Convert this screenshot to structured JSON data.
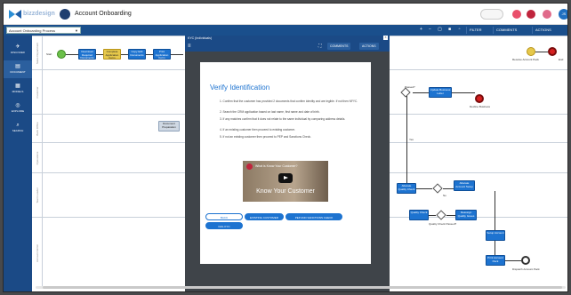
{
  "app": {
    "brand": "bizzdesign",
    "title": "Account Onboarding"
  },
  "toolbar": {
    "process_select": "Account Onboarding Process",
    "filter_label": "FILTER",
    "comments_label": "COMMENTS",
    "actions_label": "ACTIONS",
    "avatar_initials": "JS"
  },
  "sidebar": {
    "items": [
      {
        "label": "DISCOVER",
        "icon": "compass-icon"
      },
      {
        "label": "DOCUMENT",
        "icon": "document-icon"
      },
      {
        "label": "MODELS",
        "icon": "models-icon"
      },
      {
        "label": "EXPLORE",
        "icon": "explore-icon"
      },
      {
        "label": "SEARCH",
        "icon": "search-icon"
      }
    ]
  },
  "diagram": {
    "lanes": [
      "Sales Department",
      "Customer",
      "Back Office",
      "Operations",
      "Team Leader",
      "Account Admin"
    ],
    "tasks": {
      "t1": "Download Required Documents",
      "t2": "Complete Application Form",
      "t3": "Copy Edit Documents",
      "t4": "Print Application Form",
      "t5": "Document Preparation",
      "t6": "Update Business Letter",
      "t7": "Allocate Quality Check",
      "t8": "Allocate Account Setup",
      "t9": "Quality Check",
      "t10": "Reassign Quality Issues",
      "t11": "Setup Account",
      "t12": "Print Account Pack"
    },
    "labels": {
      "start": "Start",
      "end": "End",
      "passed": "Passed?",
      "yes": "Yes",
      "no": "No",
      "decline": "Decline Business",
      "received": "Receive Account Pack",
      "dispatch": "Dispatch Account Pack",
      "quality_passed": "Quality Check Passed?"
    }
  },
  "modal": {
    "header": "KYC (Individuals)",
    "comments_label": "COMMENTS",
    "actions_label": "ACTIONS",
    "title": "Verify Identification",
    "steps": [
      "1. Confirm that the customer has provided 2 documents that confirm identity and are legible. If not then NFYC.",
      "2. Search the CRM application based on last name, first name and date of birth.",
      "3. If any matches confirm that it does not relate to the same individual by comparing address details.",
      "4. If an existing customer then proceed to existing customer.",
      "5. If not an existing customer then proceed to PEP and Sanctions Check."
    ],
    "video": {
      "title": "What is Know Your Customer?",
      "caption": "Know Your Customer"
    },
    "buttons": {
      "back": "BACK",
      "existing": "EXISTING CUSTOMER",
      "pep": "PEP AND SANCTIONS CHECK",
      "fail": "FAIL KYC"
    }
  },
  "colors": {
    "nav_bg": "#1b4a86",
    "accent": "#1d73d0",
    "overlay_bg": "#3f4449"
  }
}
